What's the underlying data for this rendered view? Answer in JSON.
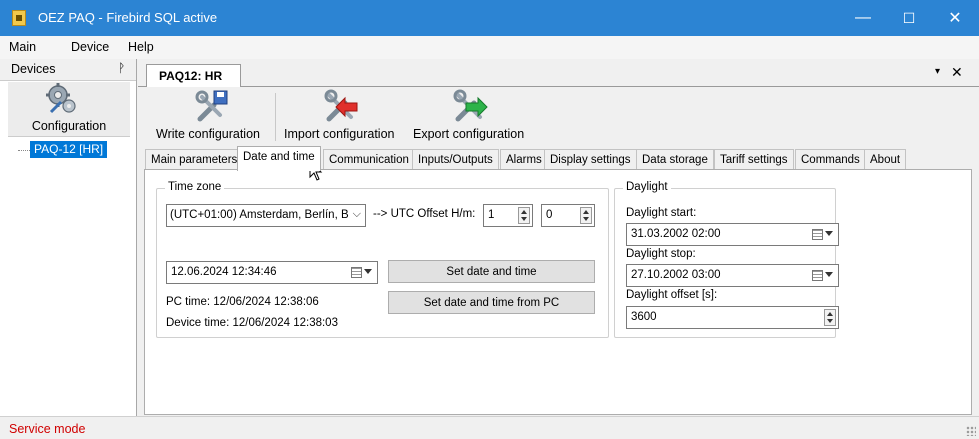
{
  "window": {
    "title": "OEZ PAQ - Firebird SQL active",
    "minimize_symbol": "—",
    "maximize_symbol": "☐",
    "close_symbol": "✕"
  },
  "menu": [
    "Main",
    "Device",
    "Help"
  ],
  "devices_panel": {
    "title": "Devices",
    "pin_symbol": "ᚹ",
    "configuration_label": "Configuration",
    "tree_items": [
      "PAQ-12 [HR]"
    ]
  },
  "document_tab": {
    "label": "PAQ12: HR",
    "dropdown_symbol": "▾",
    "close_symbol": "✕"
  },
  "toolbar": {
    "write_label": "Write configuration",
    "import_label": "Import configuration",
    "export_label": "Export configuration"
  },
  "tabs": [
    "Main parameters",
    "Date and time",
    "Communication",
    "Inputs/Outputs",
    "Alarms",
    "Display settings",
    "Data storage",
    "Tariff settings",
    "Commands",
    "About"
  ],
  "active_tab": "Date and time",
  "time_zone": {
    "legend": "Time zone",
    "selected": "(UTC+01:00) Amsterdam, Berlín, B",
    "offset_label": "--> UTC Offset H/m:",
    "offset_hours": "1",
    "offset_minutes": "0",
    "datetime_value": "12.06.2024  12:34:46",
    "set_button": "Set date and time",
    "set_from_pc_button": "Set date and time from PC",
    "pc_time": "PC time: 12/06/2024 12:38:06",
    "device_time": "Device time: 12/06/2024 12:38:03"
  },
  "daylight": {
    "legend": "Daylight",
    "start_label": "Daylight start:",
    "start_value": "31.03.2002  02:00",
    "stop_label": "Daylight stop:",
    "stop_value": "27.10.2002  03:00",
    "offset_label": "Daylight offset [s]:",
    "offset_value": "3600"
  },
  "status": {
    "text": "Service mode",
    "color": "#d00000"
  },
  "colors": {
    "titlebar": "#2c84d3",
    "selection": "#0078d7"
  }
}
